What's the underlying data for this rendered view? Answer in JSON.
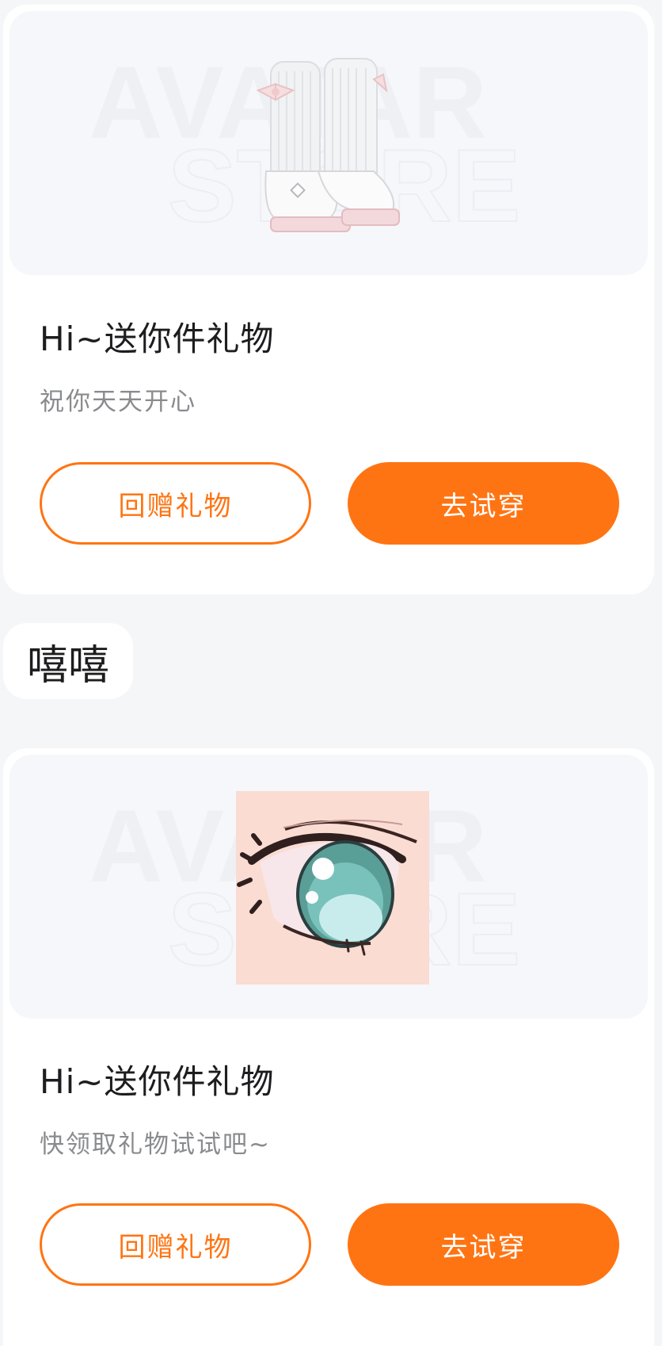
{
  "colors": {
    "accent": "#ff7412",
    "page_bg": "#f5f6f8",
    "card_bg": "#ffffff",
    "preview_bg": "#f6f7fa"
  },
  "watermark": {
    "line1": "AVATAR",
    "line2": "STORE"
  },
  "messages": [
    {
      "type": "gift-card",
      "item_icon": "white-leg-warmer-boots",
      "title": "Hi~送你件礼物",
      "subtitle": "祝你天天开心",
      "secondary_button": "回赠礼物",
      "primary_button": "去试穿"
    },
    {
      "type": "text",
      "text": "嘻嘻"
    },
    {
      "type": "gift-card",
      "item_icon": "anime-eye",
      "title": "Hi~送你件礼物",
      "subtitle": "快领取礼物试试吧~",
      "secondary_button": "回赠礼物",
      "primary_button": "去试穿"
    }
  ]
}
